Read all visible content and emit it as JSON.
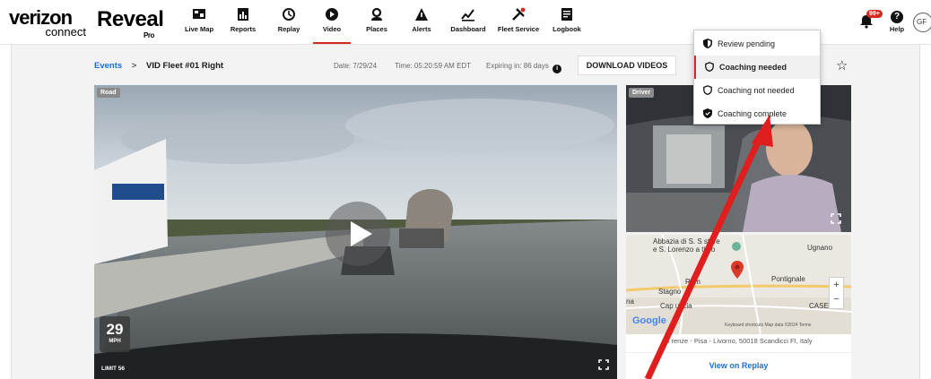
{
  "brand": {
    "logo_line1": "verizon",
    "logo_line2": "connect",
    "product": "Reveal",
    "product_sub": "Pro"
  },
  "nav": {
    "items": [
      {
        "label": "Live Map",
        "icon": "live-map-icon"
      },
      {
        "label": "Reports",
        "icon": "reports-icon"
      },
      {
        "label": "Replay",
        "icon": "replay-icon"
      },
      {
        "label": "Video",
        "icon": "video-icon",
        "active": true
      },
      {
        "label": "Places",
        "icon": "places-icon"
      },
      {
        "label": "Alerts",
        "icon": "alerts-icon"
      },
      {
        "label": "Dashboard",
        "icon": "dashboard-icon"
      },
      {
        "label": "Fleet Service",
        "icon": "fleet-service-icon"
      },
      {
        "label": "Logbook",
        "icon": "logbook-icon"
      }
    ],
    "notification_badge": "99+",
    "help_label": "Help",
    "avatar_initials": "GF"
  },
  "breadcrumb": {
    "events": "Events",
    "separator": ">",
    "current": "VID Fleet #01 Right"
  },
  "event_meta": {
    "date": "Date: 7/29/24",
    "time": "Time: 05:20:59 AM EDT",
    "expiring": "Expiring in: 86 days",
    "info_icon": "i"
  },
  "actions": {
    "download": "DOWNLOAD VIDEOS"
  },
  "road_video": {
    "tag": "Road",
    "speed": "29",
    "speed_unit": "MPH",
    "limit": "LIMIT 56"
  },
  "driver_video": {
    "tag": "Driver"
  },
  "map": {
    "labels": {
      "abbazia": "Abbazia di S. S  store",
      "lorenzo": "e S. Lorenzo a   timo",
      "ugnano": "Ugnano",
      "roma": "Rom",
      "stagno": "Stagno",
      "pontignale": "Pontignale",
      "na": "na",
      "cap": "Cap      uccia",
      "caselli": "CASELLI"
    },
    "google": "Google",
    "footer": "Keyboard shortcuts   Map data ©2024   Terms",
    "zoom_in": "+",
    "zoom_out": "−",
    "address": "S      renze - Pisa - Livorno, 50018 Scandicci FI, Italy",
    "view_replay": "View on Replay"
  },
  "coaching_menu": {
    "items": [
      {
        "label": "Review pending",
        "icon": "shield-half-icon"
      },
      {
        "label": "Coaching needed",
        "icon": "shield-outline-icon",
        "selected": true
      },
      {
        "label": "Coaching not needed",
        "icon": "shield-outline-icon"
      },
      {
        "label": "Coaching complete",
        "icon": "shield-check-icon"
      }
    ]
  },
  "colors": {
    "accent": "#d52b1e",
    "link": "#1a6fd1"
  }
}
